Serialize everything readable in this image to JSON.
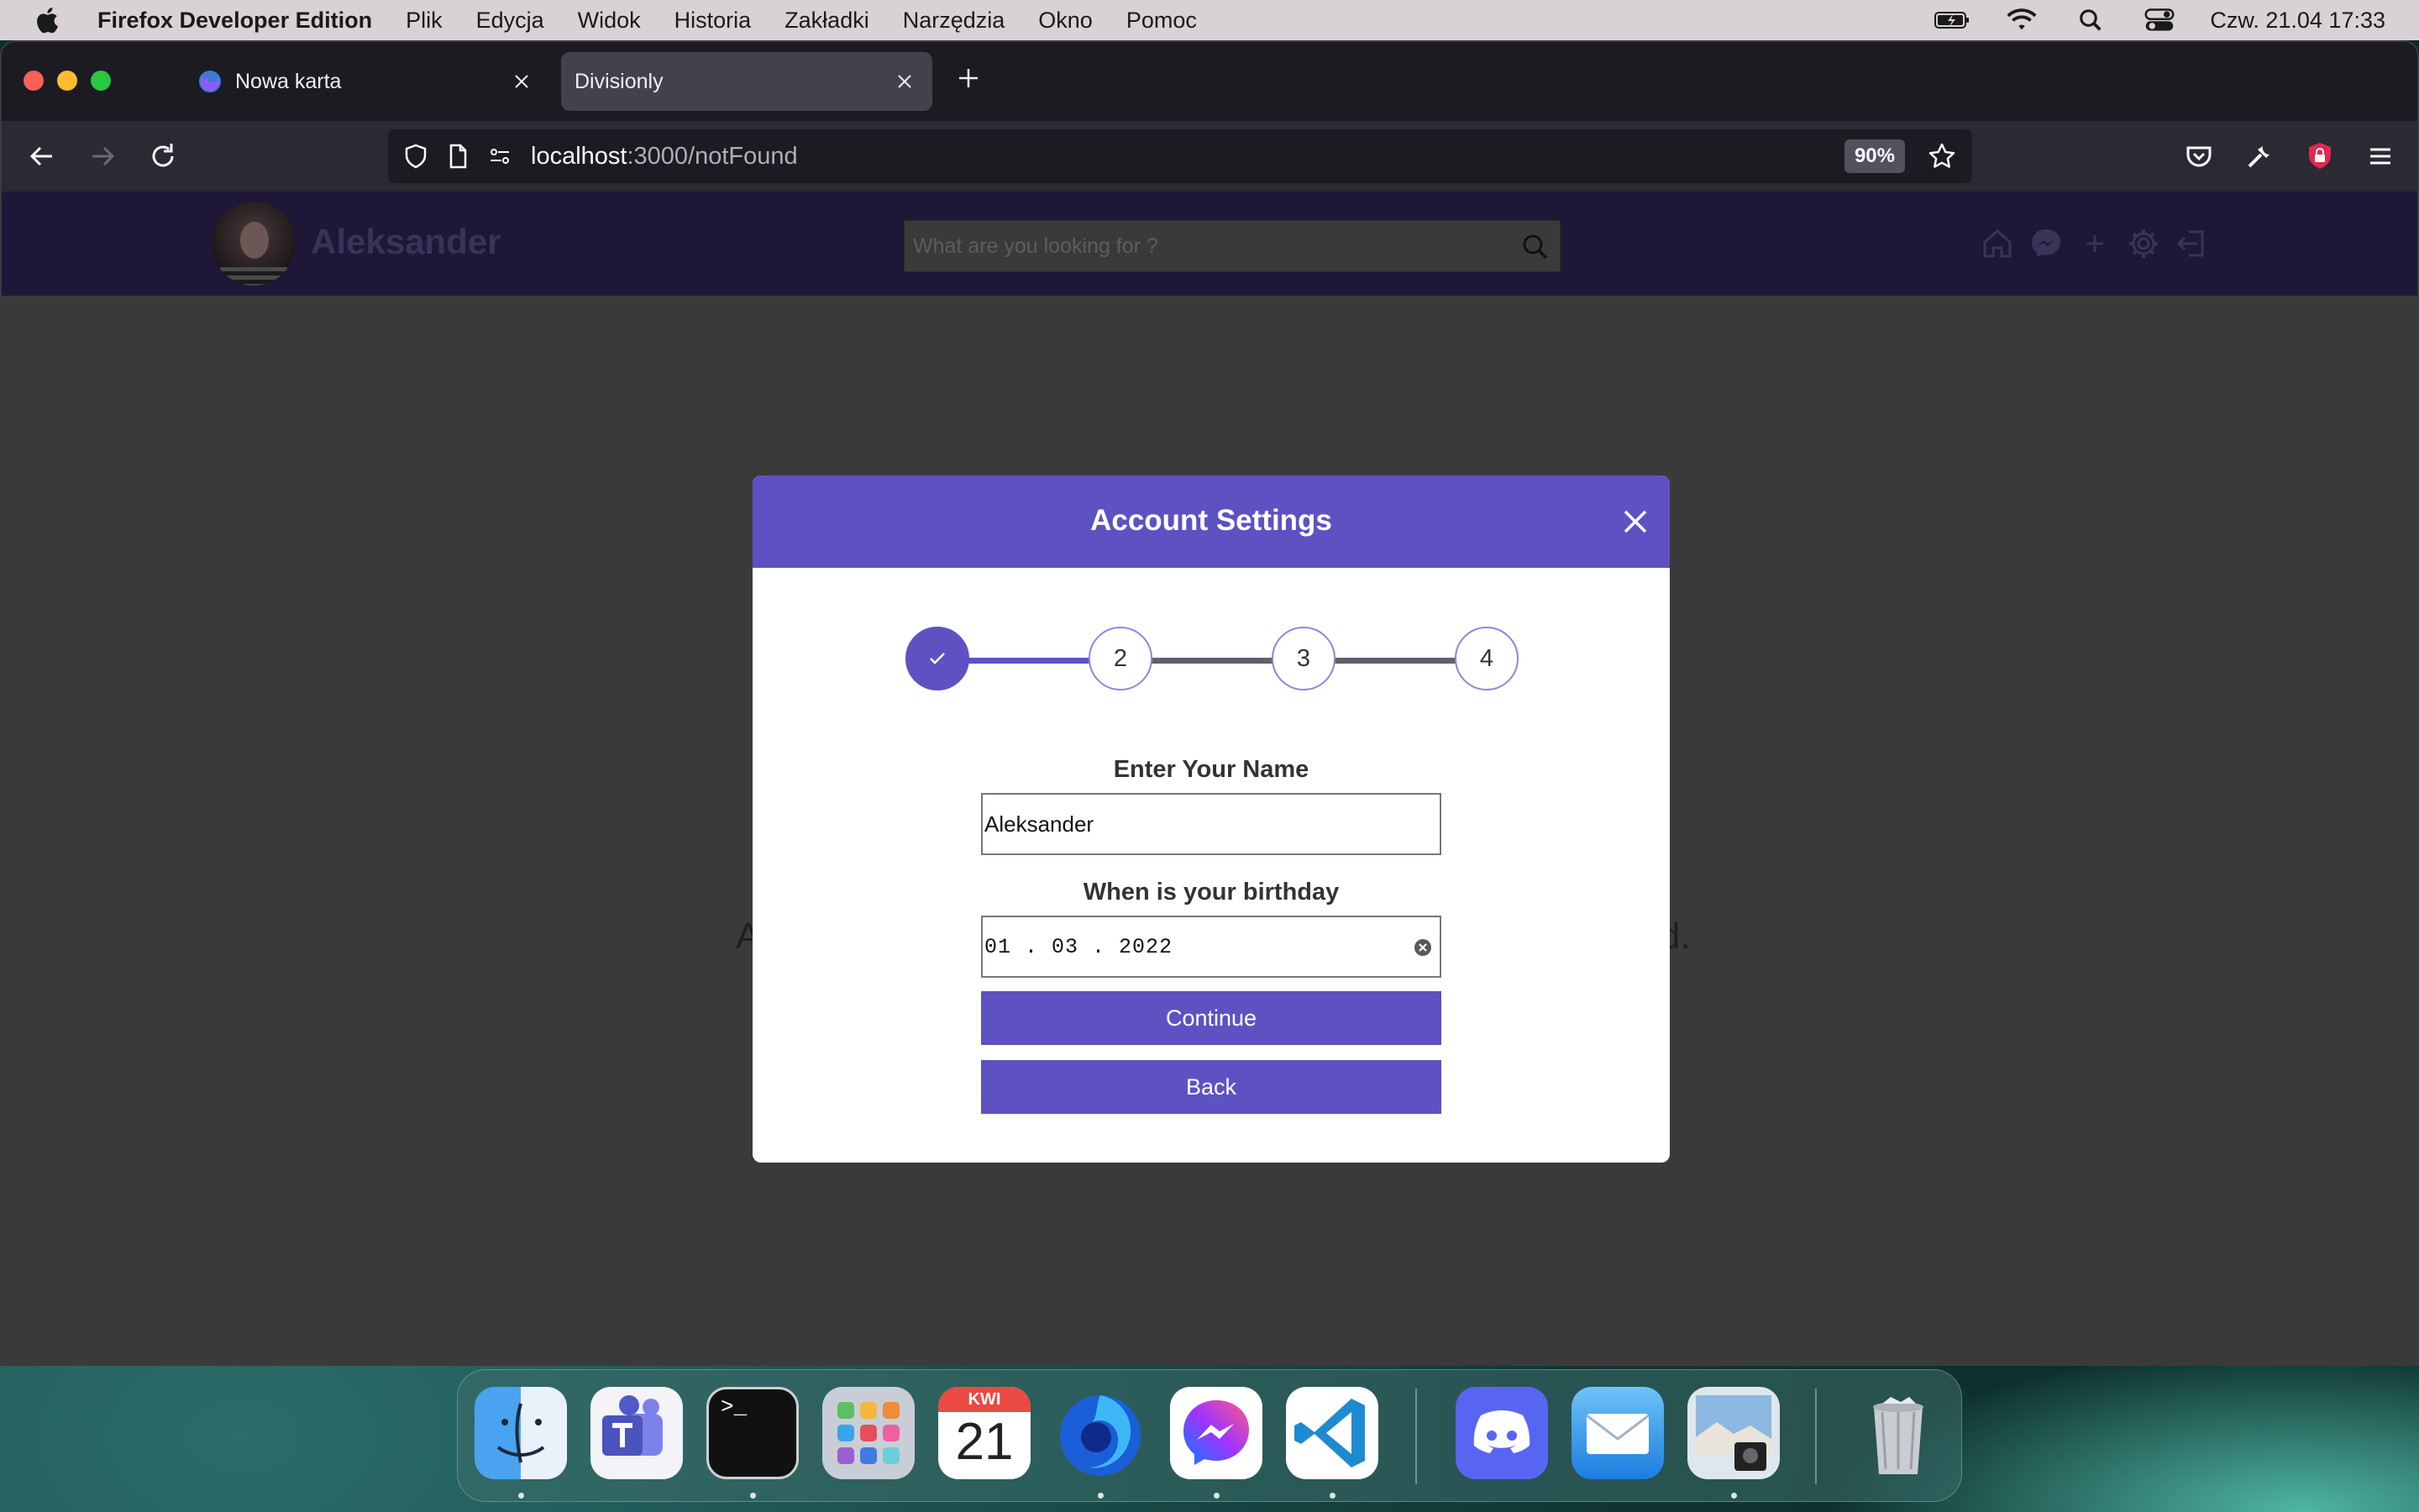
{
  "menubar": {
    "app_name": "Firefox Developer Edition",
    "items": [
      "Plik",
      "Edycja",
      "Widok",
      "Historia",
      "Zakładki",
      "Narzędzia",
      "Okno",
      "Pomoc"
    ],
    "clock": "Czw. 21.04  17:33"
  },
  "browser": {
    "tabs": [
      {
        "title": "Nowa karta",
        "active": false
      },
      {
        "title": "Divisionly",
        "active": true
      }
    ],
    "url_host": "localhost",
    "url_path": ":3000/notFound",
    "zoom": "90%"
  },
  "app": {
    "username": "Aleksander",
    "search_placeholder": "What are you looking for ?",
    "bg_text_left": "A",
    "bg_text_right": "d."
  },
  "modal": {
    "title": "Account Settings",
    "steps": [
      "✓",
      "2",
      "3",
      "4"
    ],
    "name_label": "Enter Your Name",
    "name_value": "Aleksander",
    "birthday_label": "When is your birthday",
    "birthday_value": "01 . 03 . 2022",
    "continue_label": "Continue",
    "back_label": "Back"
  },
  "dock": {
    "apps": [
      "finder-icon",
      "teams-icon",
      "terminal-icon",
      "launchpad-icon",
      "calendar-icon",
      "firefox-icon",
      "messenger-icon",
      "vscode-icon",
      "discord-icon",
      "mail-icon",
      "preview-icon",
      "trash-icon"
    ],
    "calendar_month": "KWI",
    "calendar_day": "21",
    "terminal_prompt": ">_"
  },
  "colors": {
    "accent": "#5e52c3",
    "header_bg": "#1e1738",
    "page_bg": "#3a3a3a"
  }
}
